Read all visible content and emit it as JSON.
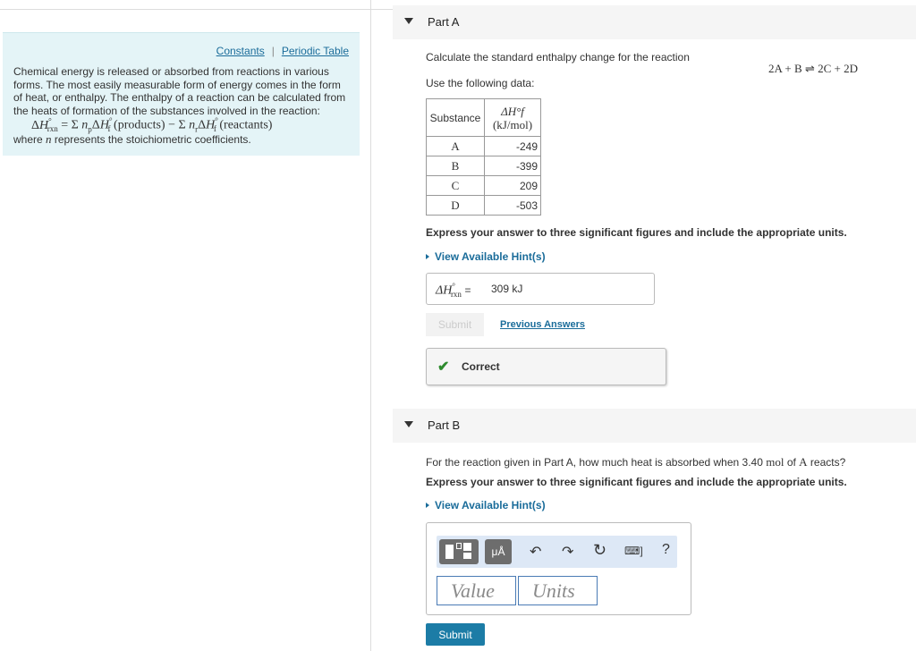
{
  "sidebar": {
    "constants_link": "Constants",
    "separator": "|",
    "periodic_table_link": "Periodic Table",
    "intro": "Chemical energy is released or absorbed from reactions in various forms. The most easily measurable form of energy comes in the form of heat, or enthalpy. The enthalpy of a reaction can be calculated from the heats of formation of the substances involved in the reaction:",
    "formula": "ΔH°rxn = Σ npΔH°f (products) − Σ nrΔH°f (reactants)",
    "where_prefix": "where",
    "where_var": "n",
    "where_suffix": "represents the stoichiometric coefficients."
  },
  "partA": {
    "title": "Part A",
    "question": "Calculate the standard enthalpy change for the reaction",
    "reaction": "2A + B ⇌ 2C + 2D",
    "use_data": "Use the following data:",
    "table": {
      "headers": [
        "Substance",
        "ΔH°f",
        "(kJ/mol)"
      ],
      "rows": [
        {
          "substance": "A",
          "value": "-249"
        },
        {
          "substance": "B",
          "value": "-399"
        },
        {
          "substance": "C",
          "value": "209"
        },
        {
          "substance": "D",
          "value": "-503"
        }
      ]
    },
    "instruction": "Express your answer to three significant figures and include the appropriate units.",
    "hint_link": "View Available Hint(s)",
    "answer_label": "ΔH°rxn =",
    "answer_value": "309 kJ",
    "submit": "Submit",
    "previous_answers": "Previous Answers",
    "feedback": "Correct"
  },
  "partB": {
    "title": "Part B",
    "question_pre": "For the reaction given in Part A, how much heat is absorbed when 3.40",
    "question_unit": "mol",
    "question_mid": "of",
    "question_var": "A",
    "question_post": "reacts?",
    "instruction": "Express your answer to three significant figures and include the appropriate units.",
    "hint_link": "View Available Hint(s)",
    "toolbar": {
      "units_button": "μÅ",
      "undo": "↶",
      "redo": "↷",
      "reset": "↻",
      "keyboard": "⌨]",
      "help": "?"
    },
    "value_placeholder": "Value",
    "units_placeholder": "Units",
    "submit": "Submit"
  }
}
